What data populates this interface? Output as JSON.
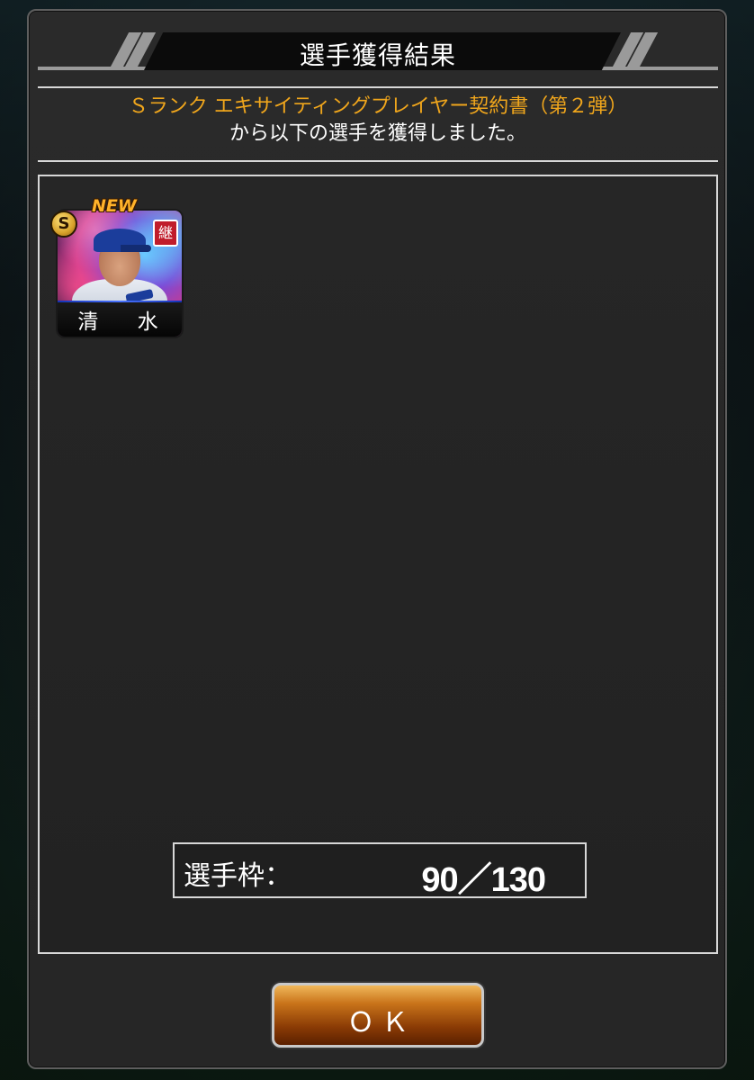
{
  "dialog": {
    "title": "選手獲得結果",
    "message_line1": "Ｓランク エキサイティングプレイヤー契約書（第２弾）",
    "message_line2": "から以下の選手を獲得しました。"
  },
  "players": [
    {
      "name": "清 水",
      "rank": "S",
      "new_label": "NEW",
      "badge": "継"
    }
  ],
  "slot": {
    "label": "選手枠：",
    "value": "90／130"
  },
  "buttons": {
    "ok_label": "ＯＫ"
  },
  "colors": {
    "highlight_text": "#f0a61c",
    "button_orange": "#c9741a",
    "inherit_badge": "#c01c2b"
  }
}
